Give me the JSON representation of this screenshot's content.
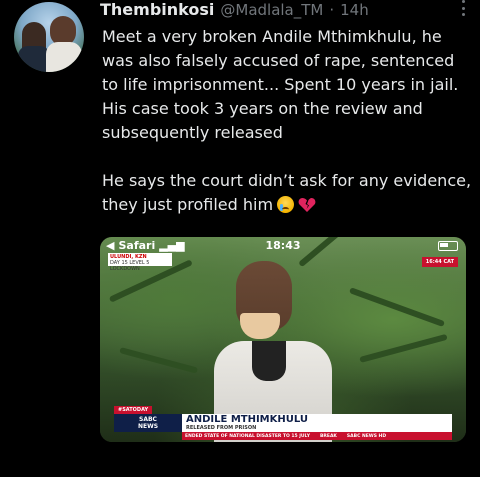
{
  "tweet": {
    "author_name": "Thembinkosi",
    "author_handle": "@Madlala_TM",
    "separator": "·",
    "time": "14h",
    "paragraph1": "Meet a very broken Andile Mthimkhulu, he was also falsely accused of rape, sentenced to  life imprisonment... Spent 10 years in jail. His case took 3 years on the review and subsequently released",
    "paragraph2": "He says the court didn’t ask for any evidence, they just profiled him",
    "emojis": [
      "crying-face-icon",
      "broken-heart-icon"
    ]
  },
  "media": {
    "status_app": "Safari",
    "status_time": "18:43",
    "ticker_line1": "ULUNDI, KZN",
    "ticker_line2": "DAY 15 LEVEL 5 LOCKDOWN",
    "corner_badge": "16:44 CAT",
    "program_tag": "#SATODAY",
    "channel_line1": "SABC",
    "channel_line2": "NEWS",
    "strap_name": "ANDILE MTHIMKHULU",
    "strap_sub": "RELEASED FROM PRISON",
    "crawl_text": "ENDED STATE OF NATIONAL DISASTER TO 15 JULY",
    "crawl_break": "BREAK",
    "crawl_site": "SABC NEWS HD"
  },
  "colors": {
    "background": "#000000",
    "text": "#e7e9ea",
    "secondary": "#71767b",
    "sabc_red": "#c8102e",
    "sabc_navy": "#0f1f48"
  }
}
